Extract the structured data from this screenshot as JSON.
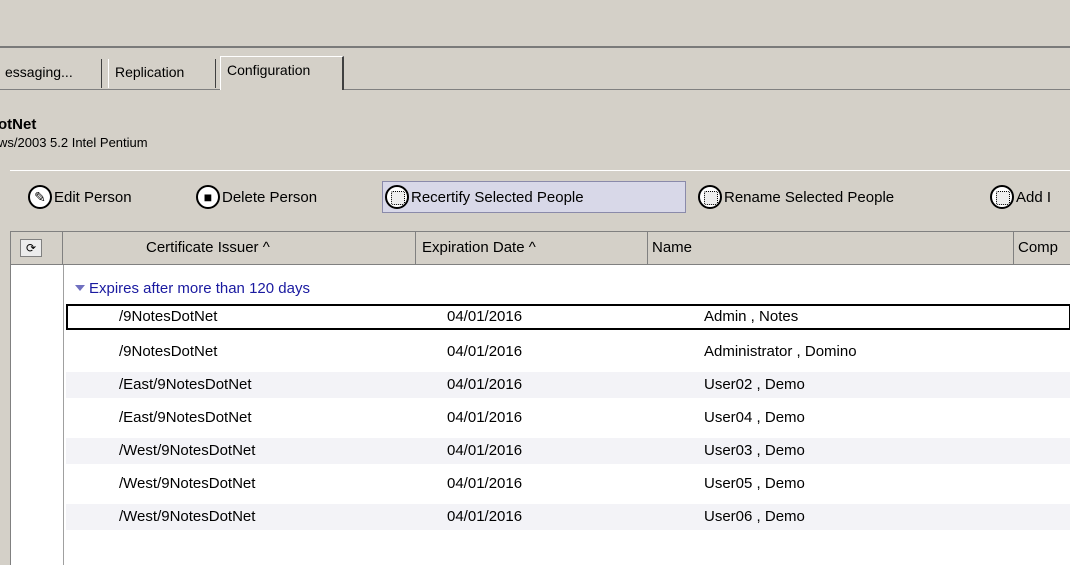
{
  "tabs": [
    {
      "label": "essaging..."
    },
    {
      "label": "Replication"
    },
    {
      "label": "Configuration"
    }
  ],
  "server": {
    "title": "otNet",
    "subtitle": "ws/2003 5.2 Intel Pentium"
  },
  "toolbar": {
    "edit_person": "Edit Person",
    "delete_person": "Delete Person",
    "recertify": "Recertify Selected People",
    "rename": "Rename Selected People",
    "add": "Add I"
  },
  "columns": {
    "issuer": "Certificate Issuer ^",
    "expiration": "Expiration Date ^",
    "name": "Name",
    "comp": "Comp"
  },
  "group": {
    "label": "Expires after more than 120 days"
  },
  "rows": [
    {
      "issuer": "/9NotesDotNet",
      "expiration": "04/01/2016",
      "name": "Admin , Notes"
    },
    {
      "issuer": "/9NotesDotNet",
      "expiration": "04/01/2016",
      "name": "Administrator , Domino"
    },
    {
      "issuer": "/East/9NotesDotNet",
      "expiration": "04/01/2016",
      "name": "User02 , Demo"
    },
    {
      "issuer": "/East/9NotesDotNet",
      "expiration": "04/01/2016",
      "name": "User04 , Demo"
    },
    {
      "issuer": "/West/9NotesDotNet",
      "expiration": "04/01/2016",
      "name": "User03 , Demo"
    },
    {
      "issuer": "/West/9NotesDotNet",
      "expiration": "04/01/2016",
      "name": "User05 , Demo"
    },
    {
      "issuer": "/West/9NotesDotNet",
      "expiration": "04/01/2016",
      "name": "User06 , Demo"
    }
  ],
  "colors": {
    "chrome": "#d4d0c8",
    "group_text": "#1a1aa0",
    "alt_row": "#f3f3f7"
  }
}
